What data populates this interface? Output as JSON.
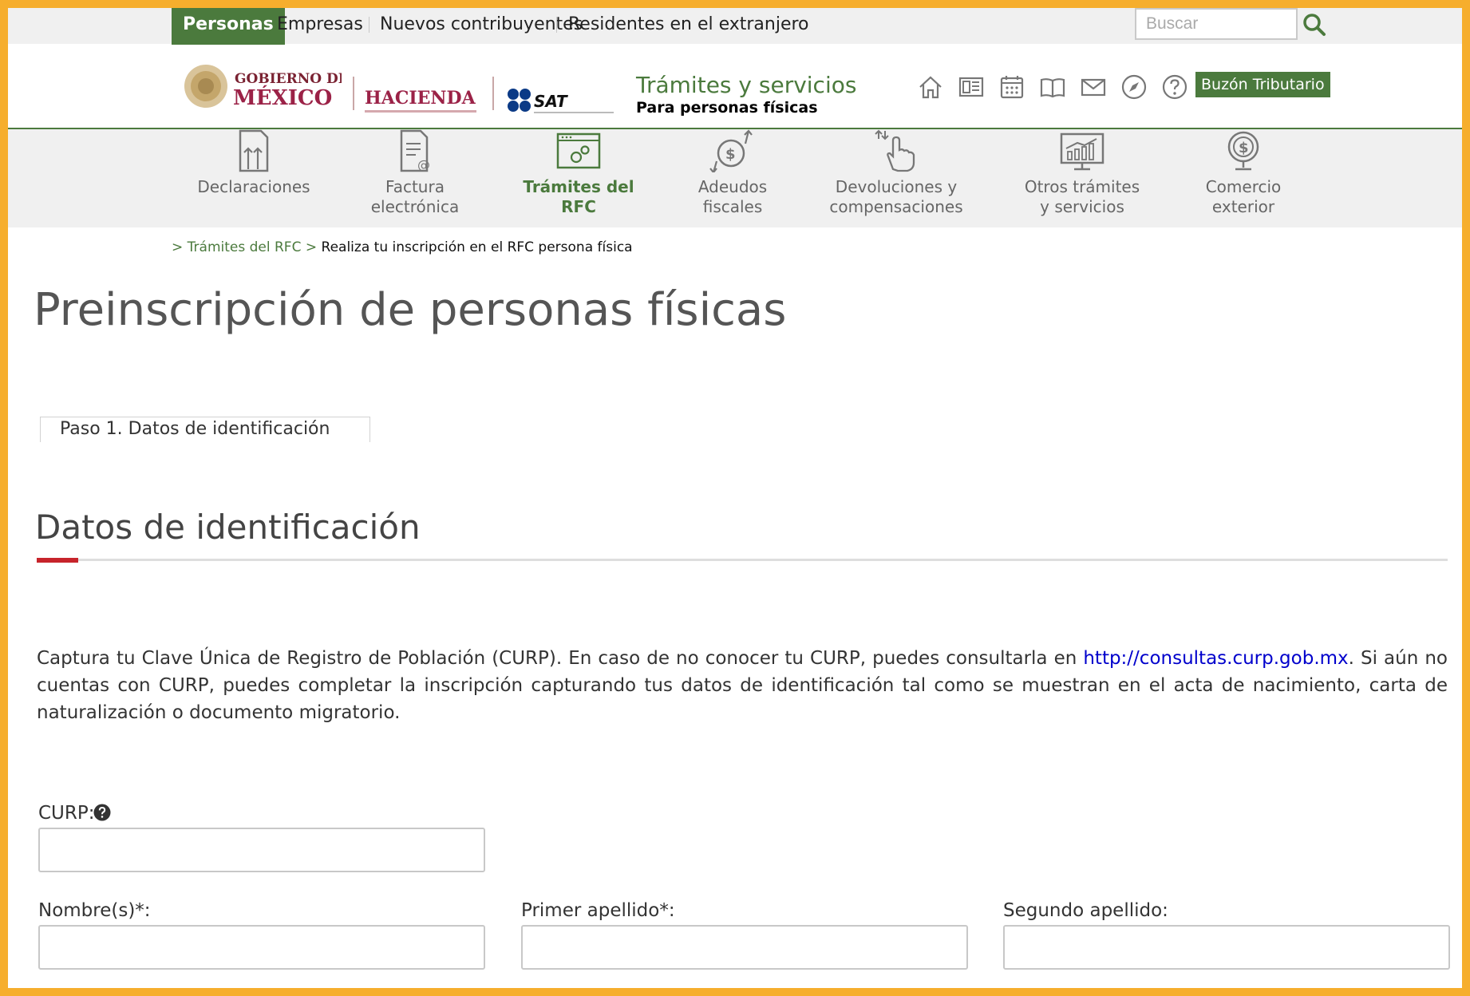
{
  "topbar": {
    "active": "Personas",
    "links": [
      "Empresas",
      "Nuevos contribuyentes",
      "Residentes en el extranjero"
    ],
    "search_placeholder": "Buscar"
  },
  "header": {
    "logos": {
      "gob_line1": "GOBIERNO DE",
      "gob_line2": "MÉXICO",
      "hacienda": "HACIENDA",
      "sat": "SAT"
    },
    "title": "Trámites y servicios",
    "subtitle": "Para personas físicas",
    "icons": [
      "home-icon",
      "news-icon",
      "calendar-icon",
      "book-icon",
      "mail-icon",
      "compass-icon",
      "help-icon"
    ],
    "buzon": "Buzón Tributario"
  },
  "nav": [
    {
      "label": "Declaraciones"
    },
    {
      "label": "Factura\nelectrónica"
    },
    {
      "label": "Trámites del\nRFC",
      "active": true
    },
    {
      "label": "Adeudos\nfiscales"
    },
    {
      "label": "Devoluciones y\ncompensaciones"
    },
    {
      "label": "Otros trámites\ny servicios"
    },
    {
      "label": "Comercio\nexterior"
    }
  ],
  "breadcrumb": {
    "sep1": ">",
    "link": "Trámites del RFC",
    "sep2": ">",
    "current": "Realiza tu inscripción en el RFC persona física"
  },
  "page": {
    "title": "Preinscripción de personas físicas",
    "step_tab": "Paso 1. Datos de identificación",
    "section_title": "Datos de identificación",
    "intro_before": "Captura tu Clave Única de Registro de Población (CURP). En caso de no conocer tu CURP, puedes consultarla en ",
    "intro_link": "http://consultas.curp.gob.mx",
    "intro_after": ". Si aún no cuentas con CURP, puedes completar la inscripción capturando tus datos de identificación tal como se muestran en el acta de nacimiento, carta de naturalización o documento migratorio."
  },
  "form": {
    "curp_label": "CURP:",
    "curp_value": "",
    "nombre_label": "Nombre(s)*:",
    "nombre_value": "",
    "primer_label": "Primer apellido*:",
    "primer_value": "",
    "segundo_label": "Segundo apellido:",
    "segundo_value": ""
  },
  "colors": {
    "brand_green": "#4B7A3D",
    "accent_red": "#C7242B",
    "frame": "#F6AE2D",
    "link_blue": "#0000CC"
  }
}
